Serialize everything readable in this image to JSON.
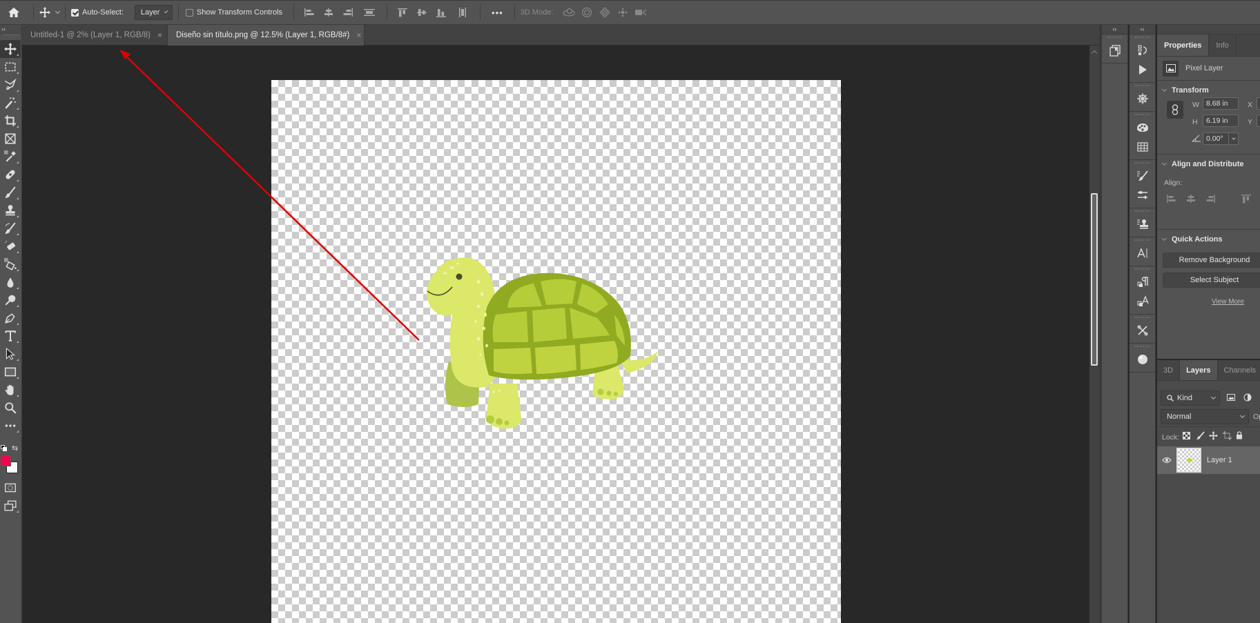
{
  "options_bar": {
    "home_icon": "home-icon",
    "move_tool_icon": "move-icon",
    "auto_select_label": "Auto-Select:",
    "auto_select_checked": true,
    "auto_select_target": "Layer",
    "show_transform_label": "Show Transform Controls",
    "show_transform_checked": false,
    "align_icons": [
      "align-left-edges-icon",
      "align-horizontal-centers-icon",
      "align-right-edges-icon",
      "distribute-horizontal-icon",
      "align-top-edges-icon",
      "align-vertical-centers-icon",
      "align-bottom-edges-icon",
      "distribute-vertical-icon"
    ],
    "more_label": "•••",
    "mode_3d_label": "3D Mode:",
    "mode_3d_icons": [
      "orbit-3d-icon",
      "roll-3d-icon",
      "drag-3d-icon",
      "slide-3d-icon",
      "scale-3d-icon"
    ]
  },
  "tabs": [
    {
      "label": "Untitled-1 @ 2% (Layer 1, RGB/8)",
      "active": false,
      "close": "×"
    },
    {
      "label": "Diseño sin título.png @ 12.5% (Layer 1, RGB/8#)",
      "active": true,
      "close": "×"
    }
  ],
  "toolbar": {
    "collapse_label": "››",
    "tools": [
      "move",
      "rectangular-marquee",
      "polygonal-lasso",
      "magic-wand",
      "crop",
      "frame",
      "eyedropper",
      "spot-healing-brush",
      "brush",
      "clone-stamp",
      "history-brush",
      "eraser",
      "paint-bucket",
      "blur",
      "dodge",
      "pen",
      "type",
      "path-selection",
      "rectangle",
      "hand",
      "zoom",
      "edit-toolbar"
    ],
    "active_tool": "move",
    "foreground_color": "#f0064a",
    "background_color": "#ffffff"
  },
  "canvas": {
    "document": "Diseño sin título.png",
    "zoom": "12.5%",
    "content": "turtle illustration on transparent background",
    "annotation": "red arrow pointing to Untitled-1 tab",
    "annotation_color": "#e00000"
  },
  "dock": {
    "collapse_label": "‹‹"
  },
  "properties": {
    "tabs": [
      "Properties",
      "Info"
    ],
    "active_tab": "Properties",
    "layer_type": "Pixel Layer",
    "transform": {
      "title": "Transform",
      "w_label": "W",
      "w_value": "8.68 in",
      "h_label": "H",
      "h_value": "6.19 in",
      "x_label": "X",
      "y_label": "Y",
      "angle_value": "0.00°"
    },
    "align": {
      "title": "Align and Distribute",
      "align_label": "Align:"
    },
    "quick_actions": {
      "title": "Quick Actions",
      "remove_bg": "Remove Background",
      "select_subject": "Select Subject",
      "view_more": "View More"
    }
  },
  "layers_panel": {
    "tabs": [
      "3D",
      "Layers",
      "Channels"
    ],
    "active_tab": "Layers",
    "filter_kind": "Kind",
    "blend_mode": "Normal",
    "opacity_label": "Op",
    "lock_label": "Lock:",
    "layers": [
      {
        "name": "Layer 1",
        "visible": true
      }
    ]
  }
}
